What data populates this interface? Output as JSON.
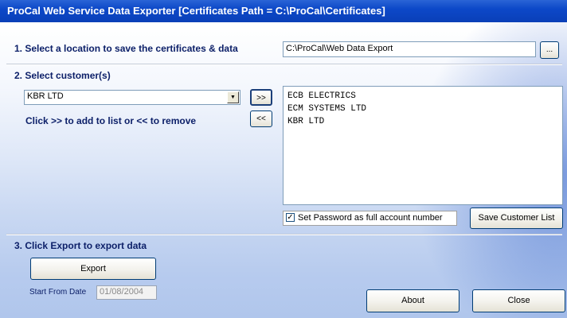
{
  "window": {
    "title": "ProCal Web Service Data Exporter [Certificates Path = C:\\ProCal\\Certificates]"
  },
  "section1": {
    "title": "1. Select a location to save the certificates & data",
    "path_value": "C:\\ProCal\\Web Data Export",
    "browse_label": "..."
  },
  "section2": {
    "title": "2. Select customer(s)",
    "selected_customer": "KBR LTD",
    "add_label": ">>",
    "remove_label": "<<",
    "hint": "Click >> to add to list or << to remove",
    "customer_list": [
      "ECB ELECTRICS",
      "ECM SYSTEMS LTD",
      "KBR LTD"
    ],
    "password_checkbox": {
      "label": "Set Password as full account number",
      "checked": true
    },
    "save_list_label": "Save Customer List"
  },
  "section3": {
    "title": "3. Click Export to export data",
    "export_label": "Export",
    "start_date_label": "Start From Date",
    "start_date_value": "01/08/2004"
  },
  "footer": {
    "about_label": "About",
    "close_label": "Close"
  },
  "colors": {
    "titlebar": "#0a3fb8",
    "section_text": "#0d2069",
    "button_border": "#003c74"
  },
  "icons": {
    "combo_arrow": "dropdown-arrow-icon",
    "checkbox_check": "checkmark-icon"
  }
}
